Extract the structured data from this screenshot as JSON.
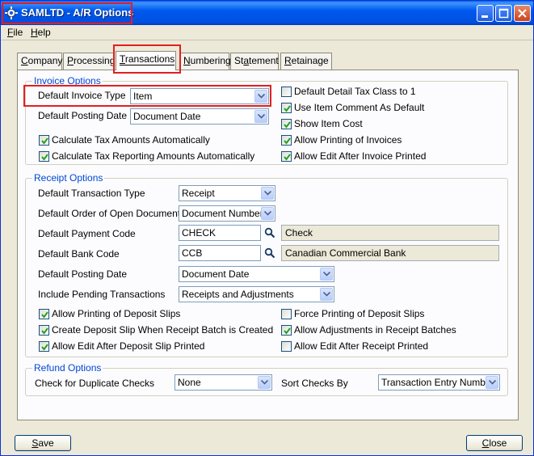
{
  "window": {
    "title": "SAMLTD - A/R Options"
  },
  "menu": [
    {
      "key": "F",
      "rest": "ile"
    },
    {
      "key": "H",
      "rest": "elp"
    }
  ],
  "tabs": [
    {
      "pre": "",
      "key": "C",
      "rest": "ompany"
    },
    {
      "pre": "",
      "key": "P",
      "rest": "rocessing"
    },
    {
      "pre": "",
      "key": "T",
      "rest": "ransactions"
    },
    {
      "pre": "",
      "key": "N",
      "rest": "umbering"
    },
    {
      "pre": "St",
      "key": "a",
      "rest": "tement"
    },
    {
      "pre": "",
      "key": "R",
      "rest": "etainage"
    }
  ],
  "invoice": {
    "title": "Invoice Options",
    "type_label": "Default Invoice Type",
    "type_value": "Item",
    "posting_label": "Default Posting Date",
    "posting_value": "Document Date",
    "calc_tax": {
      "label": "Calculate Tax Amounts Automatically",
      "checked": true
    },
    "calc_tax_rep": {
      "label": "Calculate Tax Reporting Amounts Automatically",
      "checked": true
    },
    "detail_tax": {
      "label": "Default Detail Tax Class to 1",
      "checked": false
    },
    "item_comment": {
      "label": "Use Item Comment As Default",
      "checked": true
    },
    "item_cost": {
      "label": "Show Item Cost",
      "checked": true
    },
    "allow_print": {
      "label": "Allow Printing of Invoices",
      "checked": true
    },
    "allow_edit": {
      "label": "Allow Edit After Invoice Printed",
      "checked": true
    }
  },
  "receipt": {
    "title": "Receipt Options",
    "trans_type_label": "Default Transaction Type",
    "trans_type_value": "Receipt",
    "order_label": "Default Order of Open Documents",
    "order_value": "Document Number",
    "pay_code_label": "Default Payment Code",
    "pay_code_value": "CHECK",
    "pay_code_desc": "Check",
    "bank_label": "Default Bank Code",
    "bank_value": "CCB",
    "bank_desc": "Canadian Commercial Bank",
    "posting_label": "Default Posting Date",
    "posting_value": "Document Date",
    "pending_label": "Include Pending Transactions",
    "pending_value": "Receipts and Adjustments",
    "allow_deposit_print": {
      "label": "Allow Printing of Deposit Slips",
      "checked": true
    },
    "create_deposit": {
      "label": "Create Deposit Slip When Receipt Batch is Created",
      "checked": true
    },
    "allow_edit_deposit": {
      "label": "Allow Edit After Deposit Slip Printed",
      "checked": true
    },
    "force_deposit": {
      "label": "Force Printing of Deposit Slips",
      "checked": false
    },
    "allow_adjust": {
      "label": "Allow Adjustments in Receipt Batches",
      "checked": true
    },
    "allow_edit_receipt": {
      "label": "Allow Edit After Receipt Printed",
      "checked": false
    }
  },
  "refund": {
    "title": "Refund Options",
    "dup_label": "Check for Duplicate Checks",
    "dup_value": "None",
    "sort_label": "Sort Checks By",
    "sort_value": "Transaction Entry Number"
  },
  "buttons": {
    "save": {
      "key": "S",
      "rest": "ave"
    },
    "close": {
      "key": "C",
      "rest": "lose"
    }
  },
  "colors": {
    "highlight": "#e02020",
    "group_title": "#0046d5",
    "title_bar": "#0058ee"
  }
}
